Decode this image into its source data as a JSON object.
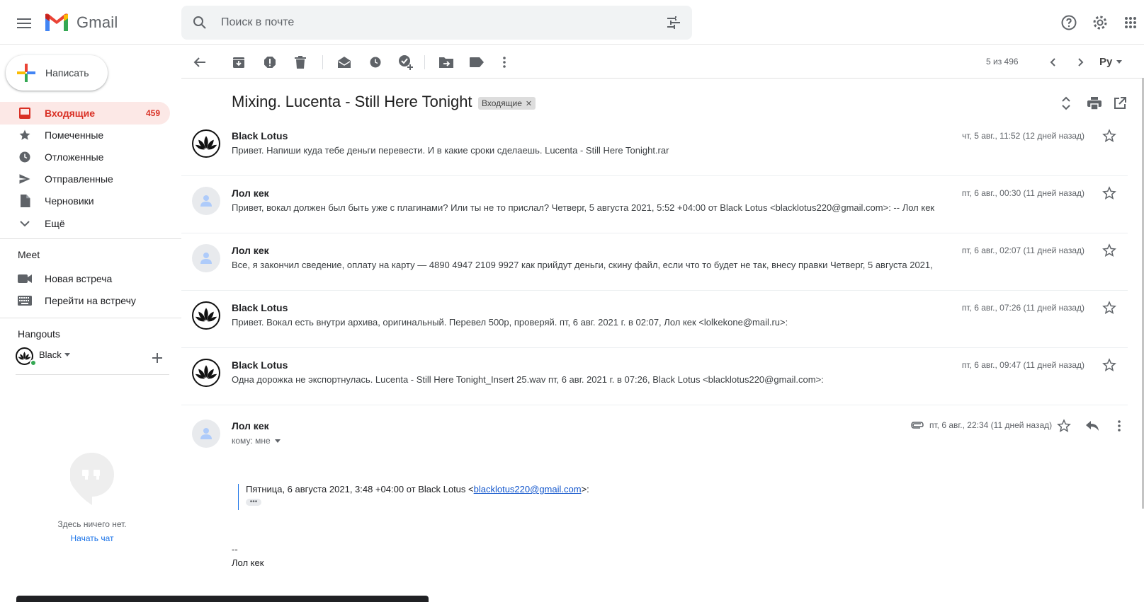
{
  "app": {
    "name": "Gmail"
  },
  "search": {
    "placeholder": "Поиск в почте"
  },
  "compose": {
    "label": "Написать"
  },
  "nav": [
    {
      "label": "Входящие",
      "count": "459",
      "icon": "inbox-icon",
      "active": true
    },
    {
      "label": "Помеченные",
      "icon": "star-icon"
    },
    {
      "label": "Отложенные",
      "icon": "clock-icon"
    },
    {
      "label": "Отправленные",
      "icon": "send-icon"
    },
    {
      "label": "Черновики",
      "icon": "draft-icon"
    },
    {
      "label": "Ещё",
      "icon": "chevron-down-icon"
    }
  ],
  "meet": {
    "title": "Meet",
    "items": [
      {
        "label": "Новая встреча",
        "icon": "video-icon"
      },
      {
        "label": "Перейти на встречу",
        "icon": "keyboard-icon"
      }
    ]
  },
  "hangouts": {
    "title": "Hangouts",
    "user": "Black",
    "empty_text": "Здесь ничего нет.",
    "start_chat": "Начать чат"
  },
  "toolbar": {
    "pager": "5 из 496",
    "lang": "Ру"
  },
  "thread": {
    "subject": "Mixing. Lucenta - Still Here Tonight",
    "label": "Входящие",
    "messages": [
      {
        "sender": "Black Lotus",
        "avatar": "lotus",
        "date": "чт, 5 авг., 11:52 (12 дней назад)",
        "snippet": "Привет. Напиши куда тебе деньги перевести. И в какие сроки сделаешь. Lucenta - Still Here Tonight.rar"
      },
      {
        "sender": "Лол кек",
        "avatar": "generic",
        "date": "пт, 6 авг., 00:30 (11 дней назад)",
        "snippet": "Привет, вокал должен был быть уже с плагинами? Или ты не то прислал? Четверг, 5 августа 2021, 5:52 +04:00 от Black Lotus <blacklotus220@gmail.com>: -- Лол кек"
      },
      {
        "sender": "Лол кек",
        "avatar": "generic",
        "date": "пт, 6 авг., 02:07 (11 дней назад)",
        "snippet": "Все, я закончил сведение, оплату на карту — 4890 4947 2109 9927 как прийдут деньги, скину файл, если что то будет не так, внесу правки Четверг, 5 августа 2021,"
      },
      {
        "sender": "Black Lotus",
        "avatar": "lotus",
        "date": "пт, 6 авг., 07:26 (11 дней назад)",
        "snippet": "Привет. Вокал есть внутри архива, оригинальный. Перевел 500р, проверяй. пт, 6 авг. 2021 г. в 02:07, Лол кек <lolkekone@mail.ru>:"
      },
      {
        "sender": "Black Lotus",
        "avatar": "lotus",
        "date": "пт, 6 авг., 09:47 (11 дней назад)",
        "snippet": "Одна дорожка не экспортнулась. Lucenta - Still Here Tonight_Insert 25.wav пт, 6 авг. 2021 г. в 07:26, Black Lotus <blacklotus220@gmail.com>:"
      }
    ],
    "expanded": {
      "sender": "Лол кек",
      "to": "кому: мне",
      "date": "пт, 6 авг., 22:34 (11 дней назад)",
      "quote_prefix": "Пятница, 6 августа 2021, 3:48 +04:00 от Black Lotus <",
      "quote_email": "blacklotus220@gmail.com",
      "quote_suffix": ">:",
      "dots": "•••",
      "sig_dashes": "--",
      "sig_name": "Лол кек"
    }
  },
  "colors": {
    "accent": "#d93025",
    "active_bg": "#fce8e6",
    "link": "#1155cc"
  }
}
